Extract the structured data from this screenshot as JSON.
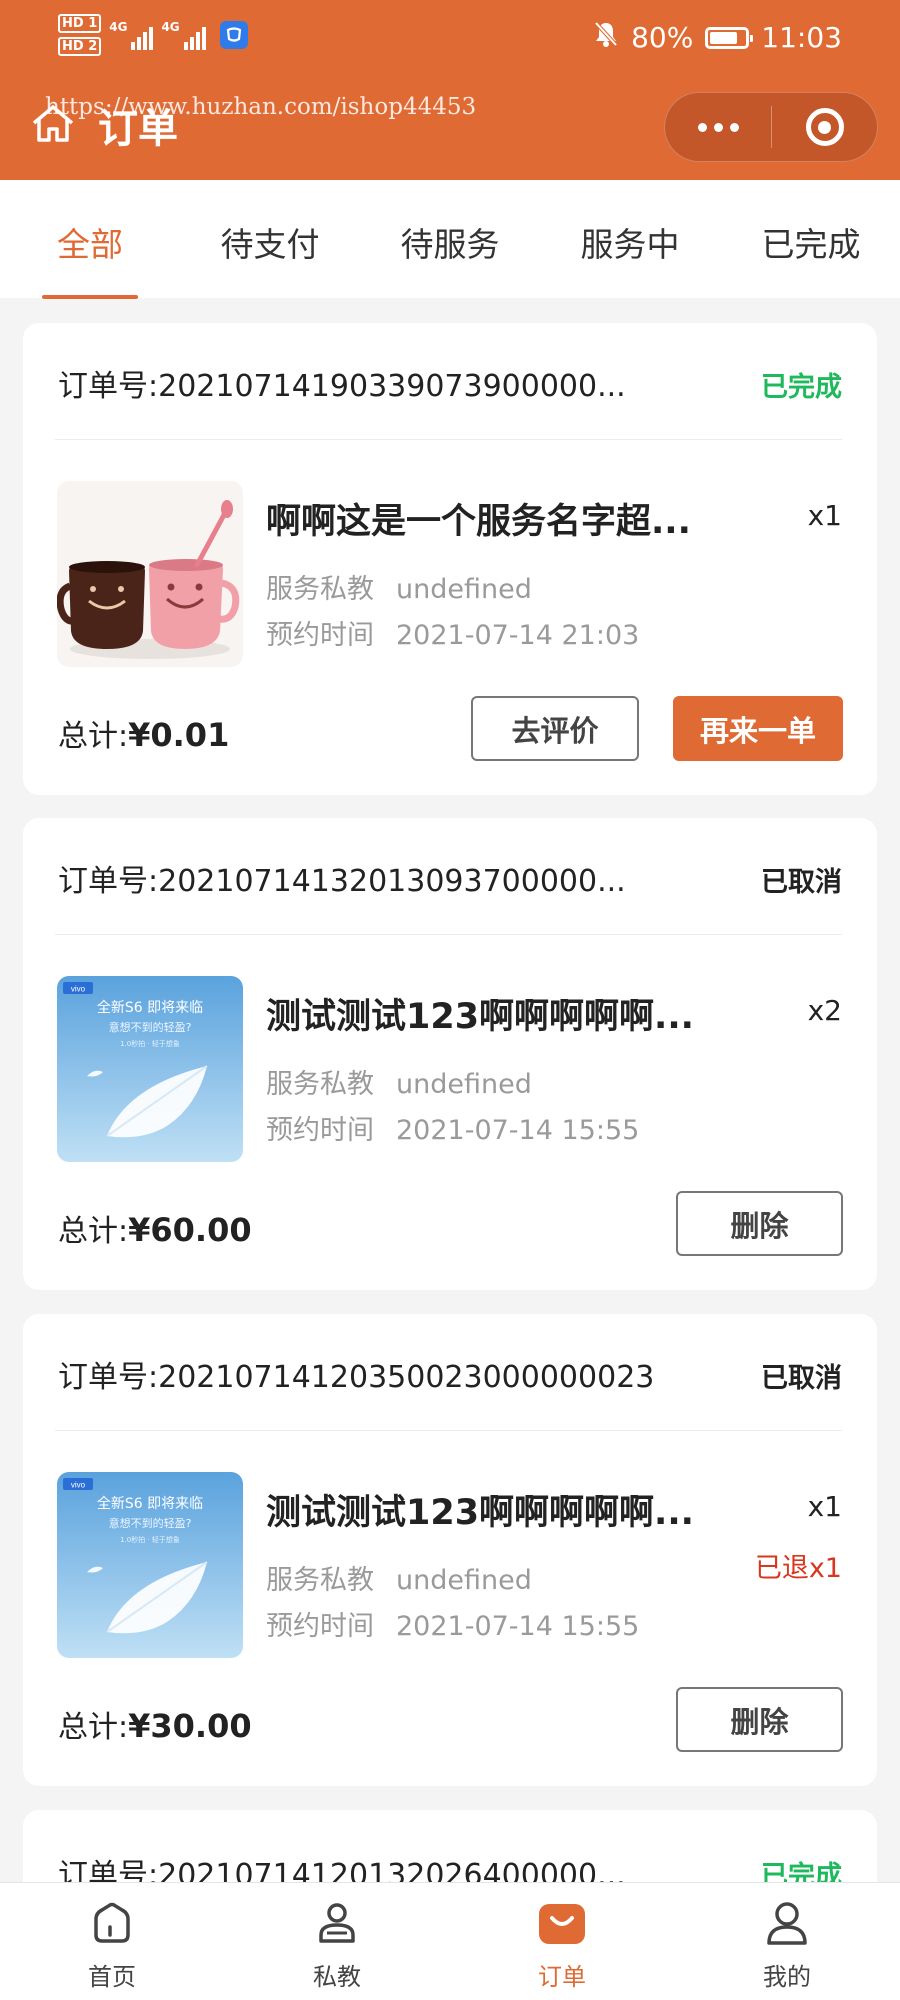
{
  "status_bar": {
    "hd1": "HD 1",
    "hd2": "HD 2",
    "net1": "4G",
    "net2": "4G",
    "battery": "80%",
    "battery_level": 0.8,
    "time": "11:03"
  },
  "header": {
    "title": "订单",
    "watermark": "https://www.huzhan.com/ishop44453",
    "accent_color": "#e06a34"
  },
  "tabs": [
    {
      "label": "全部",
      "active": true
    },
    {
      "label": "待支付",
      "active": false
    },
    {
      "label": "待服务",
      "active": false
    },
    {
      "label": "服务中",
      "active": false
    },
    {
      "label": "已完成",
      "active": false
    }
  ],
  "labels": {
    "order_no": "订单号:",
    "service_type": "服务私教",
    "appt_time": "预约时间",
    "total": "总计:"
  },
  "orders": [
    {
      "order_no": "20210714190339073900000...",
      "status": "已完成",
      "service_name": "啊啊这是一个服务名字超...",
      "thumb": "cups",
      "qty": "x1",
      "coach": "undefined",
      "appt_time": "2021-07-14 21:03",
      "total": "¥0.01",
      "buttons": [
        "去评价",
        "再来一单"
      ]
    },
    {
      "order_no": "20210714132013093700000...",
      "status": "已取消",
      "service_name": "测试测试123啊啊啊啊啊...",
      "thumb": "feather",
      "qty": "x2",
      "coach": "undefined",
      "appt_time": "2021-07-14 15:55",
      "total": "¥60.00",
      "buttons": [
        "删除"
      ]
    },
    {
      "order_no": "20210714120350023000000023",
      "status": "已取消",
      "service_name": "测试测试123啊啊啊啊啊...",
      "thumb": "feather",
      "qty": "x1",
      "refund": "已退x1",
      "coach": "undefined",
      "appt_time": "2021-07-14 15:55",
      "total": "¥30.00",
      "buttons": [
        "删除"
      ]
    },
    {
      "order_no": "20210714120132026400000...",
      "status": "已完成"
    }
  ],
  "thumb_text": {
    "brand": "vivo",
    "headline": "全新S6 即将来临",
    "tagline": "意想不到的轻盈?",
    "small": "1.0秒拍 · 轻于想象"
  },
  "bottom_nav": [
    {
      "label": "首页",
      "icon": "home-icon",
      "active": false
    },
    {
      "label": "私教",
      "icon": "coach-icon",
      "active": false
    },
    {
      "label": "订单",
      "icon": "order-bag-icon",
      "active": true
    },
    {
      "label": "我的",
      "icon": "profile-icon",
      "active": false
    }
  ]
}
